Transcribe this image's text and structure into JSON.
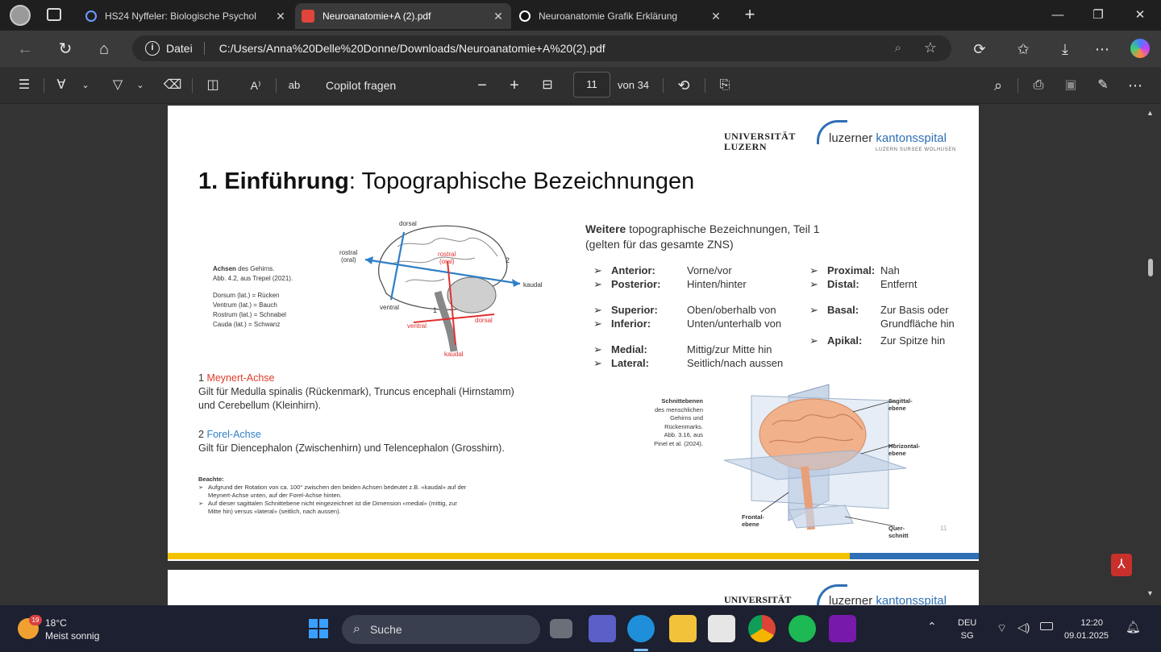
{
  "browser": {
    "tabs": [
      {
        "label": "HS24 Nyffeler: Biologische Psychol",
        "icon_color": "#5b8cff",
        "active": false
      },
      {
        "label": "Neuroanatomie+A (2).pdf",
        "icon_color": "#e0443a",
        "active": true
      },
      {
        "label": "Neuroanatomie Grafik Erklärung",
        "icon_color": "#ffffff",
        "active": false
      }
    ],
    "new_tab_glyph": "+",
    "address": {
      "protocol_label": "Datei",
      "url": "C:/Users/Anna%20Delle%20Donne/Downloads/Neuroanatomie+A%20(2).pdf"
    }
  },
  "pdf_toolbar": {
    "copilot_label": "Copilot fragen",
    "page_current": "11",
    "page_total_label": "von 34"
  },
  "slide": {
    "logo_uni_line1": "UNIVERSITÄT",
    "logo_uni_line2": "LUZERN",
    "logo_ks_a": "luzerner",
    "logo_ks_b": "kantonsspital",
    "logo_ks_sub": "LUZERN SURSEE WOLHUSEN",
    "title_bold": "1. Einführung",
    "title_rest": ": Topographische Bezeichnungen",
    "fig1": {
      "caption_bold": "Achsen",
      "caption_rest": " des Gehirns.",
      "caption_src": "Abb. 4.2, aus Trepel (2021).",
      "legend": [
        "Dorsum (lat.) = Rücken",
        "Ventrum (lat.) = Bauch",
        "Rostrum (lat.) = Schnabel",
        "Cauda (lat.) = Schwanz"
      ],
      "labels": {
        "dorsal_top": "dorsal",
        "rostral_line1": "rostral",
        "rostral_line2": "(oral)",
        "rostral_red_line1": "rostral",
        "rostral_red_line2": "(oral)",
        "num2": "2",
        "kaudal_blue": "kaudal",
        "ventral_blue": "ventral",
        "num1": "1",
        "ventral_red": "ventral",
        "dorsal_red": "dorsal",
        "kaudal_red": "kaudal"
      }
    },
    "axis1": {
      "num": "1",
      "name": "Meynert-Achse",
      "text1": "Gilt für Medulla spinalis (Rückenmark), Truncus encephali (Hirnstamm)",
      "text2": "und Cerebellum (Kleinhirn)."
    },
    "axis2": {
      "num": "2",
      "name": "Forel-Achse",
      "text": "Gilt für Diencephalon (Zwischenhirn) und Telencephalon (Grosshirn)."
    },
    "note": {
      "title": "Beachte:",
      "items": [
        [
          "Aufgrund der Rotation von ca. 100° zwischen den beiden Achsen bedeutet z.B. «kaudal» auf der",
          "Meynert-Achse unten, auf der Forel-Achse hinten."
        ],
        [
          "Auf dieser sagittalen Schnittebene nicht eingezeichnet ist die Dimension «medial» (mittig, zur",
          "Mitte hin) versus «lateral» (seitlich, nach aussen)."
        ]
      ]
    },
    "right_heading_bold": "Weitere",
    "right_heading_rest": " topographische Bezeichnungen, Teil 1",
    "right_heading_line2": "(gelten für das gesamte ZNS)",
    "terms_left": [
      {
        "term": "Anterior:",
        "def": "Vorne/vor",
        "line2": ""
      },
      {
        "term": "Posterior:",
        "def": "Hinten/hinter",
        "line2": ""
      },
      {
        "term": "Superior:",
        "def": "Oben/oberhalb von",
        "line2": ""
      },
      {
        "term": "Inferior:",
        "def": "Unten/unterhalb von",
        "line2": ""
      },
      {
        "term": "Medial:",
        "def": "Mittig/zur Mitte hin",
        "line2": ""
      },
      {
        "term": "Lateral:",
        "def": "Seitlich/nach aussen",
        "line2": ""
      }
    ],
    "terms_right": [
      {
        "term": "Proximal:",
        "def": "Nah",
        "line2": ""
      },
      {
        "term": "Distal:",
        "def": "Entfernt",
        "line2": ""
      },
      {
        "term": "Basal:",
        "def": "Zur Basis oder",
        "line2": "Grundfläche hin"
      },
      {
        "term": "Apikal:",
        "def": "Zur Spitze hin",
        "line2": ""
      }
    ],
    "fig2": {
      "caption_lines": [
        "Schnittebenen",
        "des menschlichen",
        "Gehirns und",
        "Rückenmarks.",
        "Abb. 3.16, aus",
        "Pinel et al. (2024)."
      ],
      "label_sagittal_1": "Sagittal-",
      "label_sagittal_2": "ebene",
      "label_horizontal_1": "Horizontal-",
      "label_horizontal_2": "ebene",
      "label_frontal_1": "Frontal-",
      "label_frontal_2": "ebene",
      "label_quer_1": "Quer-",
      "label_quer_2": "schnitt"
    },
    "page_number": "11"
  },
  "taskbar": {
    "weather_temp": "18°C",
    "weather_desc": "Meist sonnig",
    "weather_badge": "19",
    "search_label": "Suche",
    "lang_line1": "DEU",
    "lang_line2": "SG",
    "time": "12:20",
    "date": "09.01.2025"
  }
}
